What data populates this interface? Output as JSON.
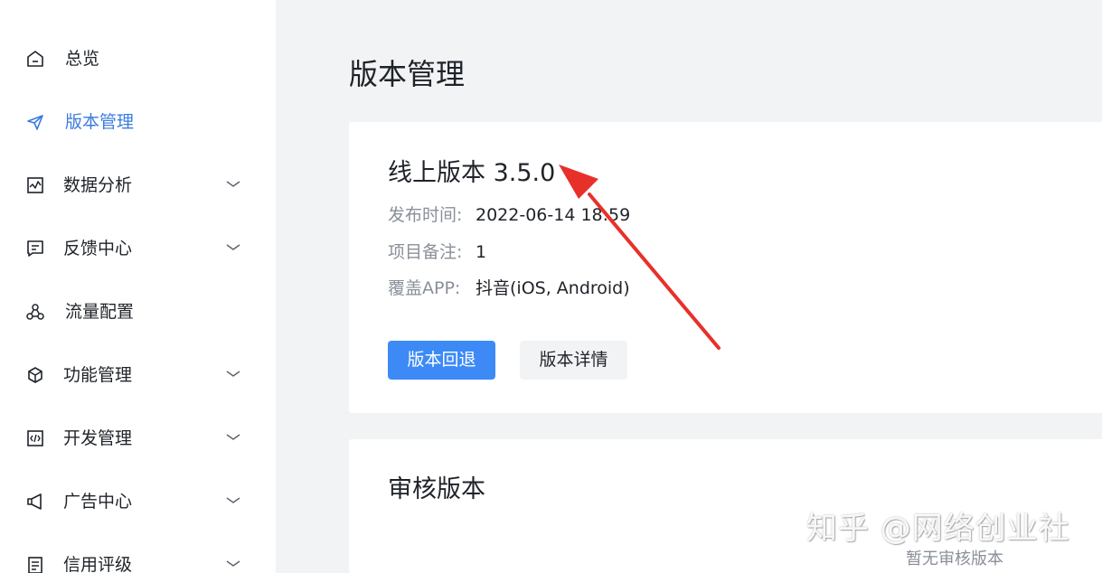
{
  "sidebar": {
    "items": [
      {
        "label": "总览",
        "icon": "home-icon",
        "active": false,
        "expandable": false
      },
      {
        "label": "版本管理",
        "icon": "send-icon",
        "active": true,
        "expandable": false
      },
      {
        "label": "数据分析",
        "icon": "chart-icon",
        "active": false,
        "expandable": true
      },
      {
        "label": "反馈中心",
        "icon": "message-icon",
        "active": false,
        "expandable": true
      },
      {
        "label": "流量配置",
        "icon": "network-icon",
        "active": false,
        "expandable": false
      },
      {
        "label": "功能管理",
        "icon": "cube-icon",
        "active": false,
        "expandable": true
      },
      {
        "label": "开发管理",
        "icon": "code-icon",
        "active": false,
        "expandable": true
      },
      {
        "label": "广告中心",
        "icon": "megaphone-icon",
        "active": false,
        "expandable": true
      },
      {
        "label": "信用评级",
        "icon": "document-icon",
        "active": false,
        "expandable": true
      }
    ]
  },
  "main": {
    "title": "版本管理",
    "online_card": {
      "title": "线上版本 3.5.0",
      "rows": [
        {
          "label": "发布时间:",
          "value": "2022-06-14 18:59"
        },
        {
          "label": "项目备注:",
          "value": "1"
        },
        {
          "label": "覆盖APP:",
          "value": "抖音(iOS, Android)"
        }
      ],
      "rollback_label": "版本回退",
      "details_label": "版本详情"
    },
    "review_card": {
      "title": "审核版本",
      "empty_text": "暂无审核版本"
    }
  },
  "watermark": "知乎 @网络创业社",
  "colors": {
    "accent": "#3d8af7",
    "active_nav": "#3a7cde",
    "annotation_arrow": "#e8302a",
    "background": "#f2f3f5"
  }
}
